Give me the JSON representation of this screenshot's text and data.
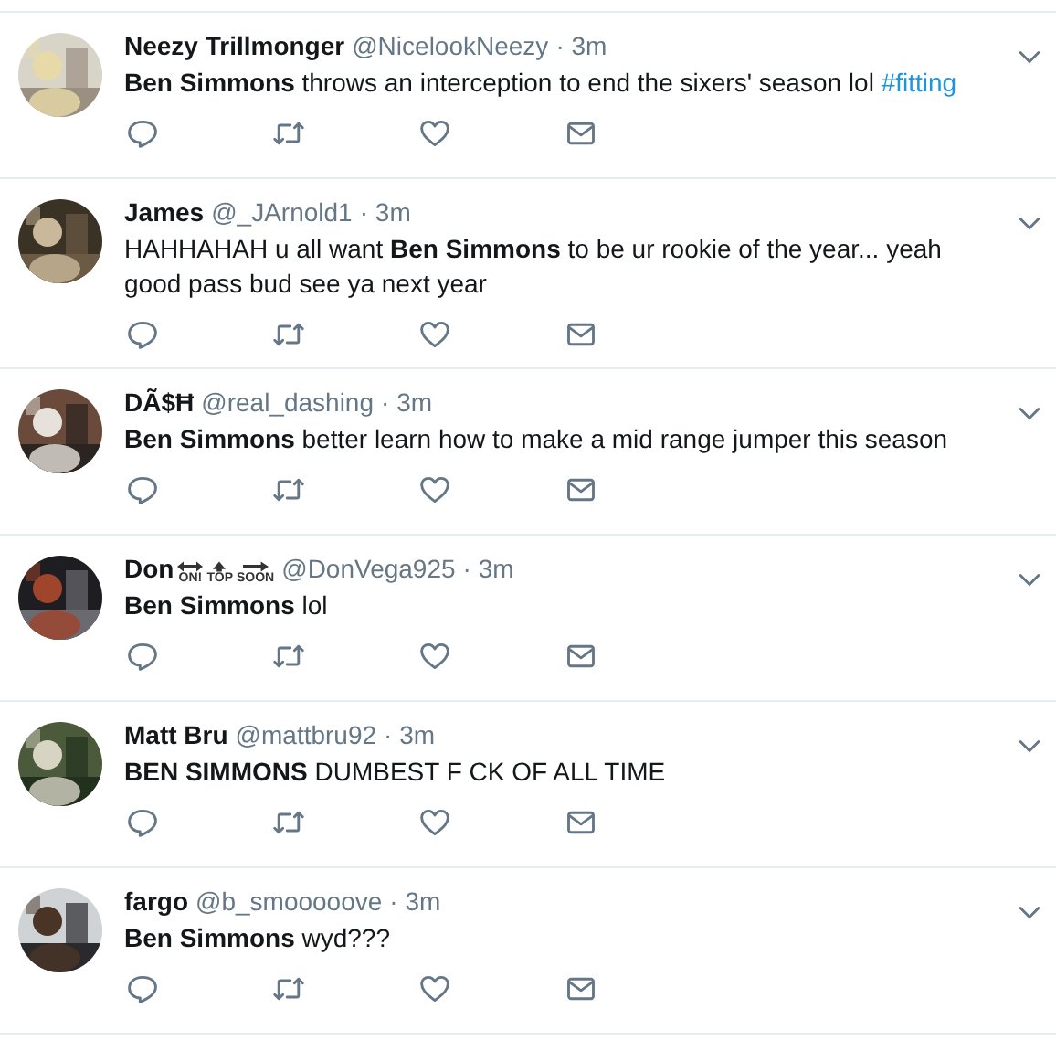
{
  "tweets": [
    {
      "name": "Neezy Trillmonger",
      "handle": "@NicelookNeezy",
      "time": "· 3m",
      "text": "**Ben Simmons** throws an interception to end the sixers' season lol",
      "hashtag": "#fitting"
    },
    {
      "name": "James",
      "handle": "@_JArnold1",
      "time": "· 3m",
      "text": "HAHHAHAH u all want **Ben Simmons** to be ur rookie of the year... yeah good pass bud see ya next year"
    },
    {
      "name": "DÃ$Ħ",
      "handle": "@real_dashing",
      "time": "· 3m",
      "text": "**Ben Simmons** better learn how to make a mid range jumper this season"
    },
    {
      "name": "Don",
      "name_badges": [
        {
          "kind": "both",
          "label": "ON!"
        },
        {
          "kind": "up",
          "label": "TOP"
        },
        {
          "kind": "right",
          "label": "SOON"
        }
      ],
      "handle": "@DonVega925",
      "time": "· 3m",
      "text": "**Ben Simmons** lol"
    },
    {
      "name": "Matt Bru",
      "handle": "@mattbru92",
      "time": "· 3m",
      "text": "**BEN SIMMONS** DUMBEST F   CK OF ALL TIME"
    },
    {
      "name": "fargo",
      "handle": "@b_smooooove",
      "time": "· 3m",
      "text": "**Ben Simmons** wyd???"
    }
  ]
}
